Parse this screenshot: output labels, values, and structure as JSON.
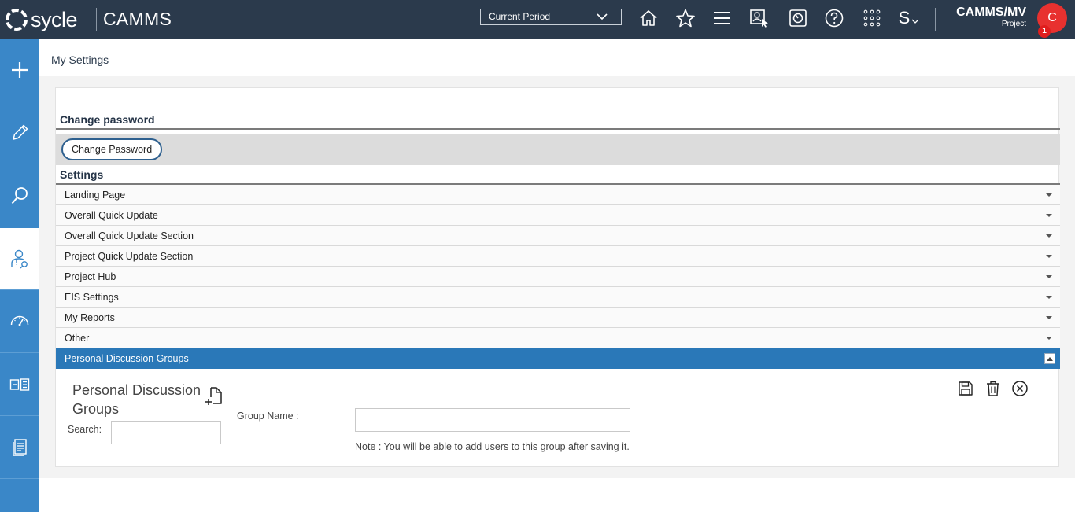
{
  "brand": {
    "logo_text": "sycle",
    "app_name": "CAMMS"
  },
  "topbar": {
    "period_select": {
      "value": "Current Period"
    },
    "icons": [
      "home-icon",
      "star-icon",
      "menu-icon",
      "user-select-icon",
      "dashboard-icon",
      "help-icon",
      "apps-grid-icon",
      "s-dropdown-icon"
    ],
    "s_label": "S",
    "user": {
      "name": "CAMMS/MV",
      "role": "Project",
      "avatar_initial": "C",
      "notification_count": "1"
    }
  },
  "sidebar": {
    "items": [
      {
        "icon": "plus-icon"
      },
      {
        "icon": "pencil-icon"
      },
      {
        "icon": "search-icon"
      },
      {
        "icon": "user-settings-icon",
        "active": true
      },
      {
        "icon": "gauge-icon"
      },
      {
        "icon": "layout-icon"
      },
      {
        "icon": "document-icon"
      }
    ]
  },
  "page": {
    "title": "My Settings"
  },
  "change_password": {
    "heading": "Change password",
    "button_label": "Change Password"
  },
  "settings": {
    "heading": "Settings",
    "sections": [
      {
        "label": "Landing Page"
      },
      {
        "label": "Overall Quick Update"
      },
      {
        "label": "Overall Quick Update Section"
      },
      {
        "label": "Project Quick Update Section"
      },
      {
        "label": "Project Hub"
      },
      {
        "label": "EIS Settings"
      },
      {
        "label": "My Reports"
      },
      {
        "label": "Other"
      },
      {
        "label": "Personal Discussion Groups",
        "expanded": true
      }
    ]
  },
  "discussion_groups": {
    "title": "Personal Discussion Groups",
    "search_label": "Search:",
    "search_value": "",
    "group_name_label": "Group Name :",
    "group_name_value": "",
    "note": "Note : You will be able to add users to this group after saving it.",
    "actions": [
      "save-icon",
      "delete-icon",
      "close-icon"
    ]
  },
  "colors": {
    "topbar": "#2b3a4c",
    "sidebar": "#3a87c8",
    "accordion_active": "#2a78b8",
    "avatar": "#e8312f"
  }
}
